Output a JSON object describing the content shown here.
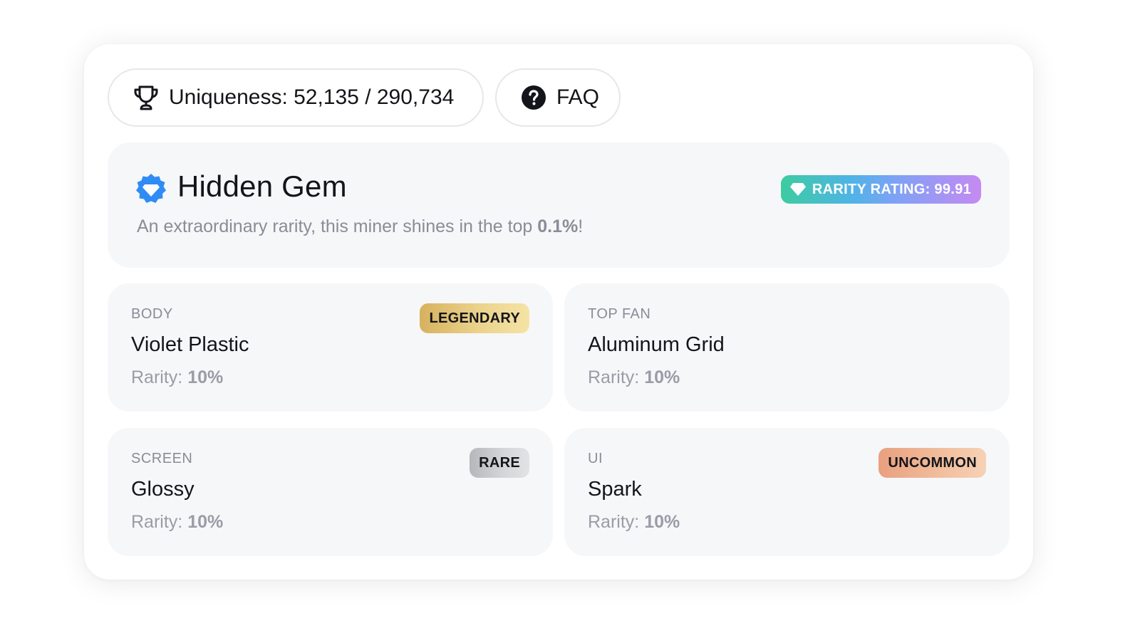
{
  "header": {
    "uniqueness_label": "Uniqueness: 52,135 / 290,734",
    "faq_label": "FAQ"
  },
  "hero": {
    "title": "Hidden Gem",
    "description_prefix": "An extraordinary rarity, this miner shines in the top ",
    "description_percent": "0.1%",
    "description_suffix": "!",
    "rating_label": "RARITY RATING: 99.91",
    "icon": "gem-badge-icon"
  },
  "traits": [
    {
      "label": "BODY",
      "name": "Violet Plastic",
      "rarity_prefix": "Rarity: ",
      "rarity_value": "10%",
      "badge": "LEGENDARY"
    },
    {
      "label": "TOP FAN",
      "name": "Aluminum Grid",
      "rarity_prefix": "Rarity: ",
      "rarity_value": "10%",
      "badge": ""
    },
    {
      "label": "SCREEN",
      "name": "Glossy",
      "rarity_prefix": "Rarity: ",
      "rarity_value": "10%",
      "badge": "RARE"
    },
    {
      "label": "UI",
      "name": "Spark",
      "rarity_prefix": "Rarity: ",
      "rarity_value": "10%",
      "badge": "UNCOMMON"
    }
  ],
  "colors": {
    "text_primary": "#14151a",
    "text_muted": "#8a8c96",
    "panel_bg": "#f6f7f9",
    "gem_blue": "#2f8cf5",
    "legendary": "#e6c679",
    "rare": "#c9cacd",
    "uncommon": "#efb493"
  }
}
